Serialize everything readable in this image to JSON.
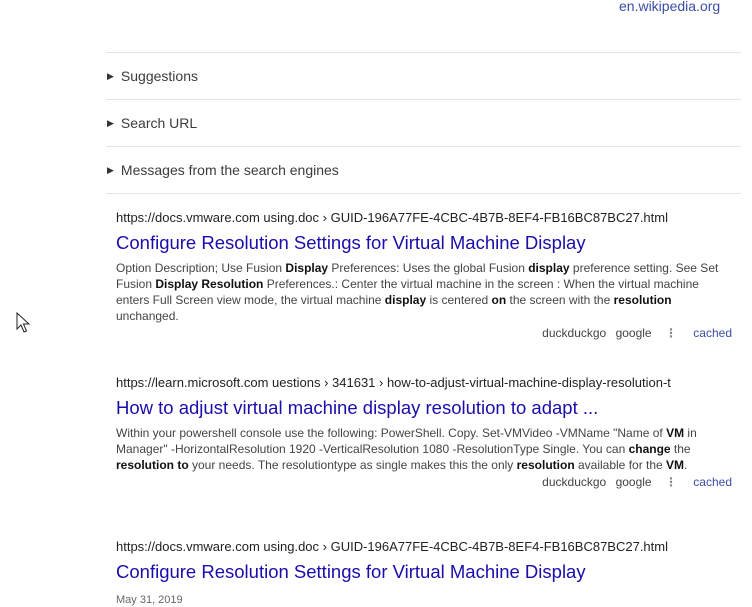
{
  "top_source": "en.wikipedia.org",
  "sections": [
    {
      "label": "Suggestions"
    },
    {
      "label": "Search URL"
    },
    {
      "label": "Messages from the search engines"
    }
  ],
  "results": [
    {
      "url": "https://docs.vmware.com  using.doc › GUID-196A77FE-4CBC-4B7B-8EF4-FB16BC87BC27.html",
      "title": "Configure Resolution Settings for Virtual Machine Display",
      "snippet": [
        {
          "t": "Option Description; Use Fusion "
        },
        {
          "t": "Display",
          "b": true
        },
        {
          "t": " Preferences: Uses the global Fusion "
        },
        {
          "t": "display",
          "b": true
        },
        {
          "t": " preference setting. See Set Fusion "
        },
        {
          "t": "Display Resolution",
          "b": true
        },
        {
          "t": " Preferences.: Center the virtual machine in the screen : When the virtual machine enters Full Screen view mode, the virtual machine "
        },
        {
          "t": "display",
          "b": true
        },
        {
          "t": " is centered "
        },
        {
          "t": "on",
          "b": true
        },
        {
          "t": " the screen with the "
        },
        {
          "t": "resolution",
          "b": true
        },
        {
          "t": " unchanged."
        }
      ],
      "actions": {
        "a": "duckduckgo",
        "b": "google",
        "menu": "⋮",
        "cached": "cached"
      }
    },
    {
      "url": "https://learn.microsoft.com  uestions › 341631 › how-to-adjust-virtual-machine-display-resolution-t",
      "title": "How to adjust virtual machine display resolution to adapt ...",
      "snippet": [
        {
          "t": "Within your powershell console use the following: PowerShell. Copy. Set-VMVideo -VMName \"Name of "
        },
        {
          "t": "VM",
          "b": true
        },
        {
          "t": " in Manager\" -HorizontalResolution 1920 -VerticalResolution 1080 -ResolutionType Single. You can "
        },
        {
          "t": "change",
          "b": true
        },
        {
          "t": " the "
        },
        {
          "t": "resolution to",
          "b": true
        },
        {
          "t": " your needs. The resolutiontype as single makes this the only "
        },
        {
          "t": "resolution",
          "b": true
        },
        {
          "t": " available for the "
        },
        {
          "t": "VM",
          "b": true
        },
        {
          "t": "."
        }
      ],
      "actions": {
        "a": "duckduckgo",
        "b": "google",
        "menu": "⋮",
        "cached": "cached"
      }
    },
    {
      "url": "https://docs.vmware.com  using.doc › GUID-196A77FE-4CBC-4B7B-8EF4-FB16BC87BC27.html",
      "title": "Configure Resolution Settings for Virtual Machine Display",
      "date": "May 31, 2019"
    }
  ]
}
